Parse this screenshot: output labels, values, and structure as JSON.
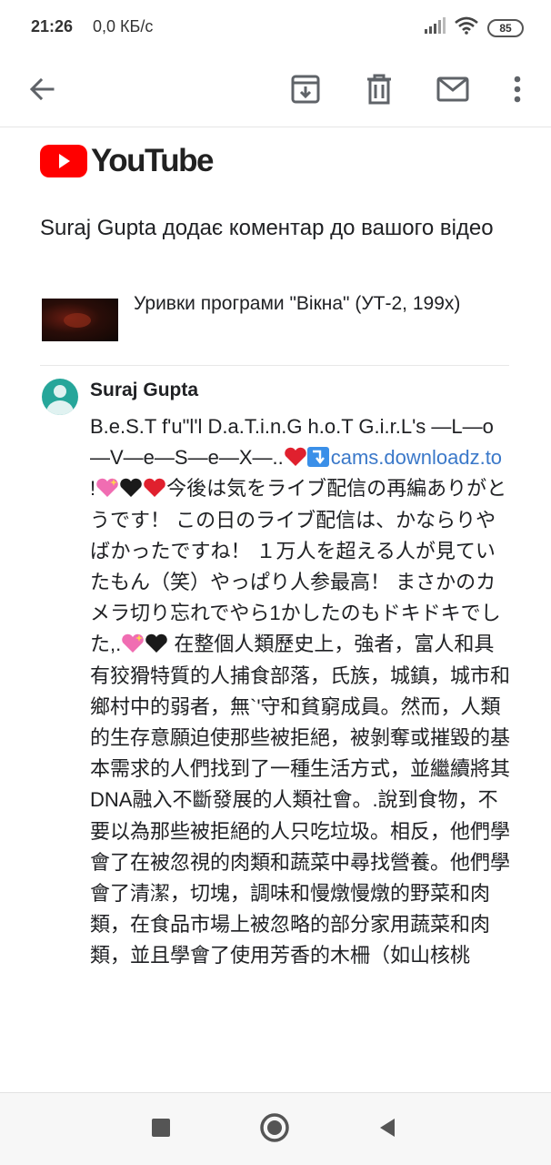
{
  "status_bar": {
    "time": "21:26",
    "network_speed": "0,0 КБ/с",
    "battery": "85",
    "icons": [
      "signal-icon",
      "wifi-icon",
      "battery-icon"
    ]
  },
  "toolbar": {
    "icons": [
      "back-arrow-icon",
      "archive-icon",
      "delete-icon",
      "mail-icon",
      "more-vert-icon"
    ]
  },
  "email": {
    "brand": "YouTube",
    "headline": "Suraj Gupta додає коментар до вашого відео",
    "video_title": "Уривки програми \"Вікна\" (УТ-2, 199х)",
    "comment": {
      "author": "Suraj Gupta",
      "text_part1": "B.e.S.T f'u\"l'l D.a.T.i.n.G h.o.T G.i.r.L's —L—o—V—e—S—e—X—..",
      "link": "cams.downloadz.to",
      "text_part2": " !",
      "text_part3": "今後は気をライブ配信の再編ありがとうです！ この日のライブ配信は、かならりやばかったですね！ １万人を超える人が見ていたもん（笑）やっぱり人参最高！ まさかのカメラ切り忘れでやら1かしたのもドキドキでした,.",
      "text_part4": " 在整個人類歷史上，強者，富人和具有狡猾特質的人捕食部落，氏族，城鎮，城市和鄉村中的弱者，無`'守和貧窮成員。然而，人類的生存意願迫使那些被拒絕，被剝奪或摧毀的基本需求的人們找到了一種生活方式，並繼續將其DNA融入不斷發展的人類社會。.說到食物，不要以為那些被拒絕的人只吃垃圾。相反，他們學會了在被忽視的肉類和蔬菜中尋找營養。他們學會了清潔，切塊，調味和慢燉慢燉的野菜和肉類，在食品市場上被忽略的部分家用蔬菜和肉類，並且學會了使用芳香的木柵（如山核桃"
    }
  },
  "nav_bar": {
    "icons": [
      "recent-apps-icon",
      "home-icon",
      "back-icon"
    ]
  }
}
